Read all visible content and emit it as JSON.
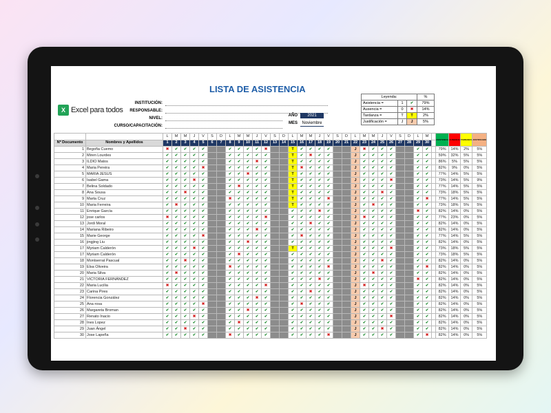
{
  "header": {
    "title": "LISTA DE ASISTENCIA",
    "logo_text": "Excel para todos",
    "logo_icon": "X",
    "fields": [
      "INSTITUCIÓN:",
      "RESPONSABLE:",
      "NIVEL:",
      "CURSO/CAPACITACIÓN:"
    ],
    "year_label": "AÑO",
    "year_value": "2021",
    "month_label": "MES",
    "month_value": "Noviembre"
  },
  "legend": {
    "title": "Leyenda:",
    "pct_label": "%",
    "rows": [
      {
        "label": "Asistencia =",
        "code": "1",
        "symbol": "✔",
        "pct": "79%"
      },
      {
        "label": "Ausencia =",
        "code": "0",
        "symbol": "✖",
        "pct": "14%"
      },
      {
        "label": "Tardanza =",
        "code": "T",
        "symbol": "T",
        "pct": "2%"
      },
      {
        "label": "Justificación =",
        "code": "J",
        "symbol": "J",
        "pct": "5%"
      }
    ]
  },
  "table": {
    "col_doc": "Nº Documento",
    "col_name": "Nombres y Apellidos",
    "day_letters": [
      "L",
      "M",
      "M",
      "J",
      "V",
      "S",
      "D",
      "L",
      "M",
      "M",
      "J",
      "V",
      "S",
      "D",
      "L",
      "M",
      "M",
      "J",
      "V",
      "S",
      "D",
      "L",
      "M",
      "M",
      "J",
      "V",
      "S",
      "D",
      "L",
      "M"
    ],
    "stat_headers": [
      "ASISTENCIA",
      "AUSENCIA",
      "TARDANZA",
      "JUSTIFICADO"
    ],
    "students": [
      {
        "n": "1",
        "name": "Begoña Cuemo",
        "s": [
          "79%",
          "14%",
          "2%",
          "5%"
        ]
      },
      {
        "n": "2",
        "name": "Miren Lourdes",
        "s": [
          "59%",
          "32%",
          "5%",
          "5%"
        ]
      },
      {
        "n": "3",
        "name": "ILDIO Matos",
        "s": [
          "86%",
          "5%",
          "5%",
          "5%"
        ]
      },
      {
        "n": "4",
        "name": "Maria Pereira",
        "s": [
          "82%",
          "9%",
          "0%",
          "5%"
        ]
      },
      {
        "n": "5",
        "name": "MARIA JESUS",
        "s": [
          "77%",
          "14%",
          "5%",
          "5%"
        ]
      },
      {
        "n": "6",
        "name": "Isabel Gama",
        "s": [
          "73%",
          "14%",
          "5%",
          "9%"
        ]
      },
      {
        "n": "7",
        "name": "Belina Soldado",
        "s": [
          "77%",
          "14%",
          "5%",
          "5%"
        ]
      },
      {
        "n": "8",
        "name": "Ana Sousa",
        "s": [
          "73%",
          "18%",
          "5%",
          "5%"
        ]
      },
      {
        "n": "9",
        "name": "Marta Cruz",
        "s": [
          "77%",
          "14%",
          "5%",
          "5%"
        ]
      },
      {
        "n": "10",
        "name": "Maria Ferreira",
        "s": [
          "73%",
          "18%",
          "5%",
          "5%"
        ]
      },
      {
        "n": "11",
        "name": "Enrique García",
        "s": [
          "82%",
          "14%",
          "0%",
          "5%"
        ]
      },
      {
        "n": "12",
        "name": "jose carlos",
        "s": [
          "77%",
          "23%",
          "0%",
          "5%"
        ]
      },
      {
        "n": "13",
        "name": "Jordi Moral",
        "s": [
          "82%",
          "14%",
          "0%",
          "5%"
        ]
      },
      {
        "n": "14",
        "name": "Mariana Ribeiro",
        "s": [
          "82%",
          "14%",
          "0%",
          "5%"
        ]
      },
      {
        "n": "15",
        "name": "Marie George",
        "s": [
          "77%",
          "14%",
          "5%",
          "5%"
        ]
      },
      {
        "n": "16",
        "name": "jingjing Liu",
        "s": [
          "82%",
          "14%",
          "0%",
          "5%"
        ]
      },
      {
        "n": "17",
        "name": "Myriam Calderón",
        "s": [
          "73%",
          "18%",
          "5%",
          "5%"
        ]
      },
      {
        "n": "17",
        "name": "Myriam Calderón",
        "s": [
          "73%",
          "18%",
          "5%",
          "5%"
        ]
      },
      {
        "n": "18",
        "name": "Montserrat Pascual",
        "s": [
          "82%",
          "14%",
          "0%",
          "5%"
        ]
      },
      {
        "n": "19",
        "name": "Elsa Oliveira",
        "s": [
          "82%",
          "14%",
          "0%",
          "5%"
        ]
      },
      {
        "n": "20",
        "name": "Maria Silva",
        "s": [
          "82%",
          "14%",
          "0%",
          "5%"
        ]
      },
      {
        "n": "21",
        "name": "VICTORIA FERNÁNDEZ",
        "s": [
          "82%",
          "14%",
          "0%",
          "5%"
        ]
      },
      {
        "n": "22",
        "name": "Maria Lucilia",
        "s": [
          "82%",
          "14%",
          "0%",
          "5%"
        ]
      },
      {
        "n": "23",
        "name": "Carina Pires",
        "s": [
          "82%",
          "14%",
          "0%",
          "5%"
        ]
      },
      {
        "n": "24",
        "name": "Florencia González",
        "s": [
          "82%",
          "14%",
          "0%",
          "5%"
        ]
      },
      {
        "n": "25",
        "name": "Ana rosa",
        "s": [
          "82%",
          "14%",
          "0%",
          "5%"
        ]
      },
      {
        "n": "26",
        "name": "Margareta Broman",
        "s": [
          "82%",
          "14%",
          "0%",
          "5%"
        ]
      },
      {
        "n": "27",
        "name": "Renato Inacio",
        "s": [
          "82%",
          "14%",
          "0%",
          "5%"
        ]
      },
      {
        "n": "28",
        "name": "Ines Lopez",
        "s": [
          "82%",
          "14%",
          "0%",
          "5%"
        ]
      },
      {
        "n": "29",
        "name": "Juan Ángel",
        "s": [
          "82%",
          "14%",
          "0%",
          "5%"
        ]
      },
      {
        "n": "30",
        "name": "Jose Lapeña",
        "s": [
          "82%",
          "14%",
          "0%",
          "5%"
        ]
      }
    ]
  }
}
